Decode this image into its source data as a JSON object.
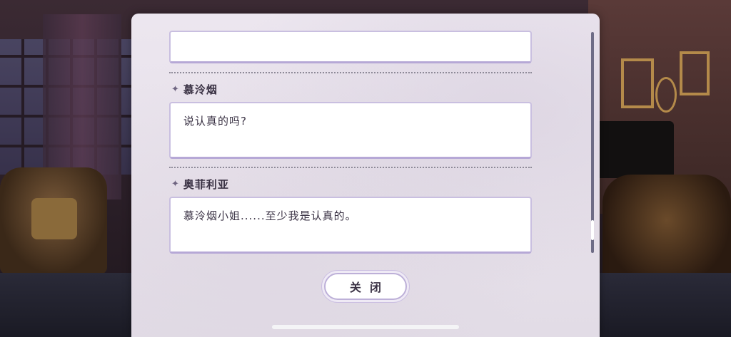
{
  "dialog_log": {
    "entries": [
      {
        "speaker": "",
        "text": ""
      },
      {
        "speaker": "慕泠烟",
        "text": "说认真的吗?"
      },
      {
        "speaker": "奥菲利亚",
        "text": "慕泠烟小姐......至少我是认真的。"
      }
    ]
  },
  "close_button": {
    "label": "关闭"
  },
  "icons": {
    "speaker_marker": "sparkle-icon"
  },
  "colors": {
    "panel_bg": "#ece6ef",
    "box_border": "#c9bfe0",
    "text": "#3a3244",
    "scrollbar": "#6e6c86"
  }
}
